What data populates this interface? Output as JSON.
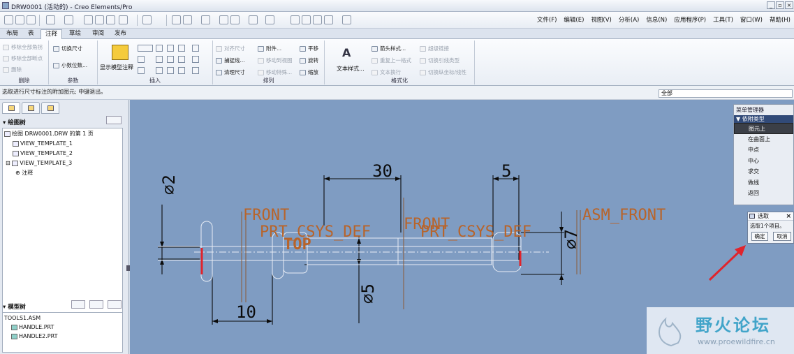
{
  "window": {
    "title": "DRW0001 (活动的) - Creo Elements/Pro"
  },
  "menu": [
    "文件(F)",
    "编辑(E)",
    "视图(V)",
    "分析(A)",
    "信息(N)",
    "应用程序(P)",
    "工具(T)",
    "窗口(W)",
    "帮助(H)"
  ],
  "tabs": [
    "布局",
    "表",
    "注释",
    "草绘",
    "审阅",
    "发布"
  ],
  "active_tab": "注释",
  "ribbon": {
    "delete_group": {
      "label": "删除",
      "items": [
        "移除全部角拐",
        "移除全部断点",
        "删除"
      ]
    },
    "params_group": {
      "label": "参数",
      "items": [
        "切换尺寸",
        "小数位数..."
      ]
    },
    "insert_group": {
      "label": "插入",
      "show_model_annotation": "显示模型注释"
    },
    "arrange_group": {
      "label": "排列",
      "items": [
        "对齐尺寸",
        "附件...",
        "平移",
        "捕捉线...",
        "移动到视图",
        "旋转",
        "清理尺寸",
        "移动特殊...",
        "缩放"
      ]
    },
    "format_group": {
      "label": "格式化",
      "text_style": "文本样式...",
      "items": [
        "箭头样式...",
        "超级链接",
        "重复上一格式",
        "切换引线类型",
        "文本换行",
        "切换纵坐标/线性"
      ]
    }
  },
  "status_message": "选取进行尺寸标注的附加图元; 中键退出。",
  "filter_value": "全部",
  "drawing_tree": {
    "title": "绘图树",
    "root": "绘图 DRW0001.DRW 的第 1 页",
    "items": [
      "VIEW_TEMPLATE_1",
      "VIEW_TEMPLATE_2",
      "VIEW_TEMPLATE_3",
      "注释"
    ]
  },
  "model_tree": {
    "title": "模型树",
    "items": [
      "TOOLS1.ASM",
      "HANDLE.PRT",
      "HANDLE2.PRT"
    ]
  },
  "drawing": {
    "dims": [
      "30",
      "5",
      "⌀2",
      "⌀7",
      "⌀5",
      "10"
    ],
    "labels": [
      "FRONT",
      "PRT_CSYS_DEF",
      "TOP",
      "FRONT",
      "PRT_CSYS_DEF",
      "ASM_FRONT"
    ]
  },
  "menu_manager": {
    "title": "菜单管理器",
    "section": "依附类型",
    "items": [
      "图元上",
      "在曲面上",
      "中点",
      "中心",
      "求交",
      "做线",
      "返回"
    ],
    "selected": "图元上"
  },
  "select_dialog": {
    "title": "选取",
    "message": "选取1个项目。",
    "ok": "确定",
    "cancel": "取消"
  },
  "watermark": {
    "cn": "野火论坛",
    "url": "www.proewildfire.cn"
  },
  "colors": {
    "graphics_bg": "#7f9cc2",
    "datum_text": "#b8642a",
    "highlight": "#e0242c",
    "selected_menu": "#3b3f47"
  }
}
